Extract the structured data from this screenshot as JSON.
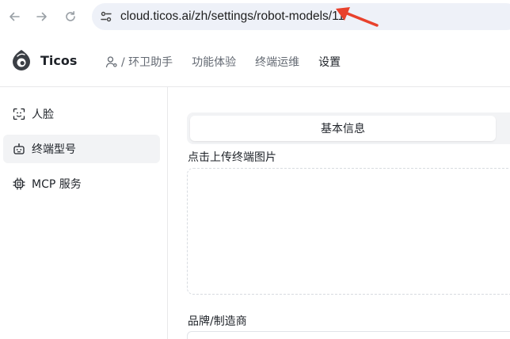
{
  "browser": {
    "url": "cloud.ticos.ai/zh/settings/robot-models/11",
    "back_icon": "arrow-left-icon",
    "forward_icon": "arrow-right-icon",
    "reload_icon": "reload-icon",
    "site_info_icon": "tune-icon",
    "annotation_color": "#e8412c"
  },
  "header": {
    "brand": "Ticos",
    "robot_selector": "/ 环卫助手",
    "nav": [
      "功能体验",
      "终端运维",
      "设置"
    ],
    "active_nav": "设置"
  },
  "sidebar": {
    "items": [
      {
        "label": "人脸",
        "icon": "face-scan-icon"
      },
      {
        "label": "终端型号",
        "icon": "robot-icon",
        "active": true
      },
      {
        "label": "MCP 服务",
        "icon": "chip-icon"
      }
    ]
  },
  "main": {
    "tab_active": "基本信息",
    "upload_label": "点击上传终端图片",
    "brand_label": "品牌/制造商"
  }
}
